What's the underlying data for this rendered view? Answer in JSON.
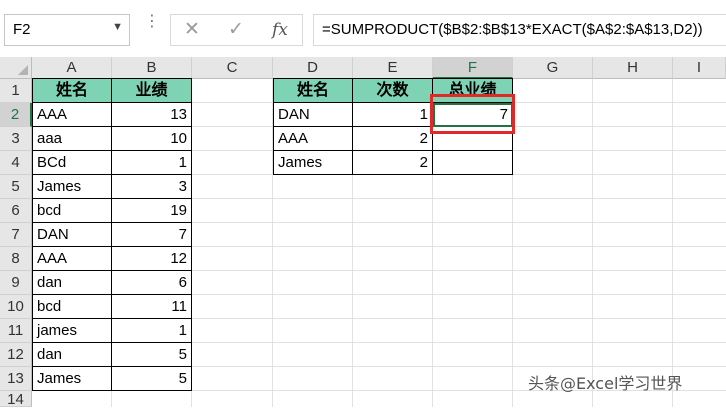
{
  "name_box": "F2",
  "formula": "=SUMPRODUCT($B$2:$B$13*EXACT($A$2:$A$13,D2))",
  "fx_label": "fx",
  "columns": [
    "A",
    "B",
    "C",
    "D",
    "E",
    "F",
    "G",
    "H",
    "I"
  ],
  "rows": [
    "1",
    "2",
    "3",
    "4",
    "5",
    "6",
    "7",
    "8",
    "9",
    "10",
    "11",
    "12",
    "13",
    "14"
  ],
  "table1": {
    "headers": [
      "姓名",
      "业绩"
    ],
    "rows": [
      [
        "AAA",
        "13"
      ],
      [
        "aaa",
        "10"
      ],
      [
        "BCd",
        "1"
      ],
      [
        "James",
        "3"
      ],
      [
        "bcd",
        "19"
      ],
      [
        "DAN",
        "7"
      ],
      [
        "AAA",
        "12"
      ],
      [
        "dan",
        "6"
      ],
      [
        "bcd",
        "11"
      ],
      [
        "james",
        "1"
      ],
      [
        "dan",
        "5"
      ],
      [
        "James",
        "5"
      ]
    ]
  },
  "table2": {
    "headers": [
      "姓名",
      "次数",
      "总业绩"
    ],
    "rows": [
      [
        "DAN",
        "1",
        "7"
      ],
      [
        "AAA",
        "2",
        ""
      ],
      [
        "James",
        "2",
        ""
      ]
    ]
  },
  "selected_cell": "F2",
  "colors": {
    "header_fill": "#7ed3b5",
    "highlight": "#e02a2a",
    "excel_green": "#217346"
  },
  "watermark": "头条@Excel学习世界"
}
